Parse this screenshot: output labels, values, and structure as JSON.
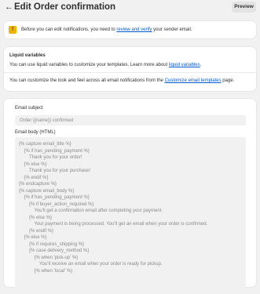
{
  "header": {
    "back_glyph": "←",
    "title": "Edit Order confirmation",
    "preview_label": "Preview"
  },
  "notice": {
    "icon": "warning-icon",
    "text_before": "Before you can edit notifications, you need to ",
    "link_text": "review and verify",
    "text_after": " your sender email."
  },
  "liquid": {
    "title": "Liquid variables",
    "line1_before": "You can use liquid variables to customize your templates. Learn more about ",
    "line1_link": "liquid variables",
    "line1_after": ".",
    "line2_before": "You can customize the look and feel across all email notifications from the ",
    "line2_link": "Customize email templates",
    "line2_after": " page."
  },
  "form": {
    "subject_label": "Email subject",
    "subject_value": "Order {{name}} confirmed",
    "body_label": "Email body (HTML)",
    "body_lines": [
      {
        "indent": 0,
        "text": "{% capture email_title %}"
      },
      {
        "indent": 1,
        "text": "{% if has_pending_payment %}"
      },
      {
        "indent": 2,
        "text": "Thank you for your order!"
      },
      {
        "indent": 1,
        "text": "{% else %}"
      },
      {
        "indent": 2,
        "text": "Thank you for your purchase!"
      },
      {
        "indent": 1,
        "text": "{% endif %}"
      },
      {
        "indent": 0,
        "text": "{% endcapture %}"
      },
      {
        "indent": 0,
        "text": "{% capture email_body %}"
      },
      {
        "indent": 1,
        "text": "{% if has_pending_payment %}"
      },
      {
        "indent": 2,
        "text": "{% if buyer_action_required %}"
      },
      {
        "indent": 3,
        "text": "You’ll get a confirmation email after completing your payment."
      },
      {
        "indent": 2,
        "text": "{% else %}"
      },
      {
        "indent": 3,
        "text": "Your payment is being processed. You'll get an email when your order is confirmed."
      },
      {
        "indent": 2,
        "text": "{% endif %}"
      },
      {
        "indent": 1,
        "text": "{% else %}"
      },
      {
        "indent": 2,
        "text": "{% if requires_shipping %}"
      },
      {
        "indent": 2,
        "text": "{% case delivery_method %}"
      },
      {
        "indent": 3,
        "text": "{% when 'pick-up' %}"
      },
      {
        "indent": 4,
        "text": "You’ll receive an email when your order is ready for pickup."
      },
      {
        "indent": 3,
        "text": "{% when 'local' %}"
      }
    ]
  }
}
